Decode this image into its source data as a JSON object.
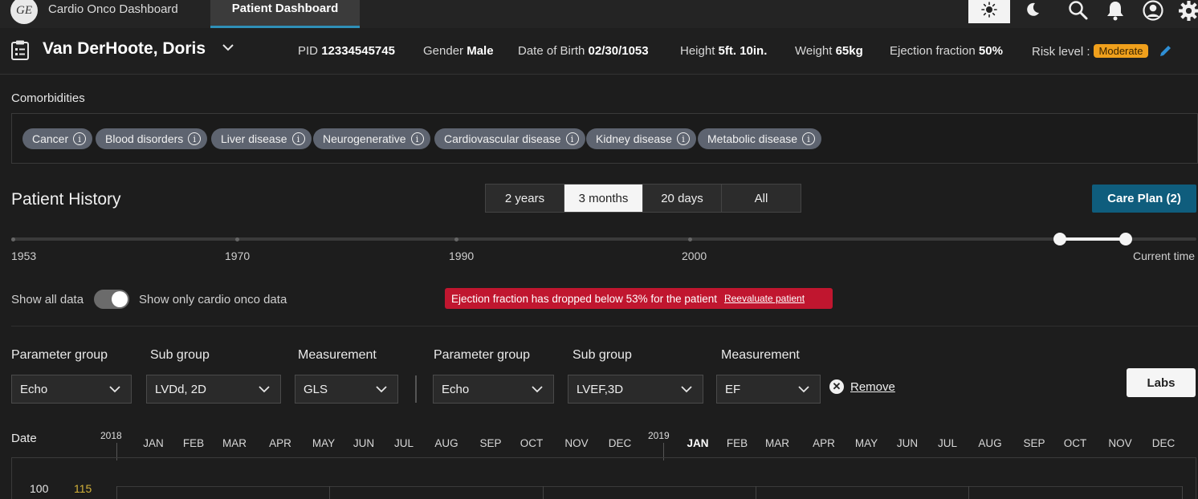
{
  "app": {
    "logo": "GE",
    "title": "Cardio Onco Dashboard",
    "active_tab": "Patient Dashboard"
  },
  "icons": [
    "sun-icon",
    "moon-icon",
    "search-icon",
    "bell-icon",
    "user-icon",
    "gear-icon"
  ],
  "patient": {
    "name": "Van DerHoote, Doris",
    "pid_label": "PID",
    "pid": "12334545745",
    "gender_label": "Gender",
    "gender": "Male",
    "dob_label": "Date of Birth",
    "dob": "02/30/1053",
    "height_label": "Height",
    "height": "5ft. 10in.",
    "weight_label": "Weight",
    "weight": "65kg",
    "ef_label": "Ejection fraction",
    "ef": "50%",
    "risk_label": "Risk level :",
    "risk": "Moderate"
  },
  "comorbidities": {
    "label": "Comorbidities",
    "chips": [
      "Cancer",
      "Blood disorders",
      "Liver disease",
      "Neurogenerative",
      "Cardiovascular disease",
      "Kidney disease",
      "Metabolic disease"
    ]
  },
  "history": {
    "title": "Patient History",
    "ranges": [
      "2 years",
      "3 months",
      "20 days",
      "All"
    ],
    "active_range": "3 months",
    "care_plan": "Care Plan (2)",
    "timeline_labels": [
      "1953",
      "1970",
      "1990",
      "2000",
      "Current time"
    ]
  },
  "toggle": {
    "left_label": "Show all data",
    "right_label": "Show only cardio onco data",
    "on": true
  },
  "alert": {
    "message": "Ejection fraction has dropped below 53% for the patient",
    "link": "Reevaluate patient"
  },
  "filters": {
    "left": {
      "group_label": "Parameter group",
      "group": "Echo",
      "sub_label": "Sub group",
      "sub": "LVDd, 2D",
      "meas_label": "Measurement",
      "meas": "GLS"
    },
    "right": {
      "group_label": "Parameter group",
      "group": "Echo",
      "sub_label": "Sub group",
      "sub": "LVEF,3D",
      "meas_label": "Measurement",
      "meas": "EF"
    },
    "remove": "Remove",
    "labs": "Labs"
  },
  "axis": {
    "date_label": "Date",
    "years": [
      "2018",
      "2019"
    ],
    "months_2018": [
      "JAN",
      "FEB",
      "MAR",
      "APR",
      "MAY",
      "JUN",
      "JUL",
      "AUG",
      "SEP",
      "OCT",
      "NOV",
      "DEC"
    ],
    "months_2019": [
      "JAN",
      "FEB",
      "MAR",
      "APR",
      "MAY",
      "JUN",
      "JUL",
      "AUG",
      "SEP",
      "OCT",
      "NOV",
      "DEC"
    ],
    "y_left": "100",
    "y_right": "115"
  },
  "colors": {
    "accent": "#0f5d7d",
    "alert": "#c0162f",
    "risk": "#f0a01c",
    "y_right": "#d4b23a"
  }
}
